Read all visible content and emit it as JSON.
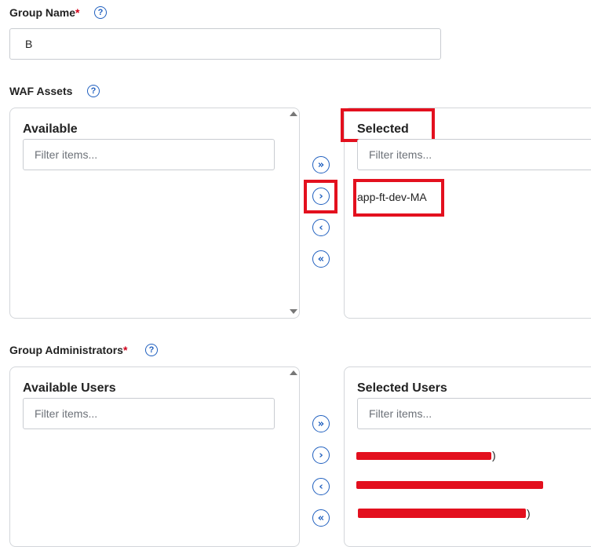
{
  "group_name": {
    "label": "Group Name",
    "required_mark": "*",
    "help_icon": "question-circle-icon",
    "value": "B"
  },
  "waf_assets": {
    "label": "WAF Assets",
    "help_icon": "question-circle-icon",
    "available": {
      "title": "Available",
      "filter_placeholder": "Filter items..."
    },
    "selected": {
      "title": "Selected",
      "filter_placeholder": "Filter items...",
      "items": [
        "app-ft-dev-MA"
      ]
    },
    "buttons": {
      "move_all_right": "»",
      "move_right": "›",
      "move_left": "‹",
      "move_all_left": "«"
    }
  },
  "group_admins": {
    "label": "Group Administrators",
    "required_mark": "*",
    "help_icon": "question-circle-icon",
    "available": {
      "title": "Available Users",
      "filter_placeholder": "Filter items..."
    },
    "selected": {
      "title": "Selected Users",
      "filter_placeholder": "Filter items...",
      "redacted_items": 3,
      "item_suffix_1": ")",
      "item_suffix_3": ")"
    },
    "buttons": {
      "move_all_right": "»",
      "move_right": "›",
      "move_left": "‹",
      "move_all_left": "«"
    }
  },
  "colors": {
    "accent": "#1f5fbf",
    "required": "#d0021b",
    "highlight": "#e3101e",
    "border": "#d3d6da"
  }
}
